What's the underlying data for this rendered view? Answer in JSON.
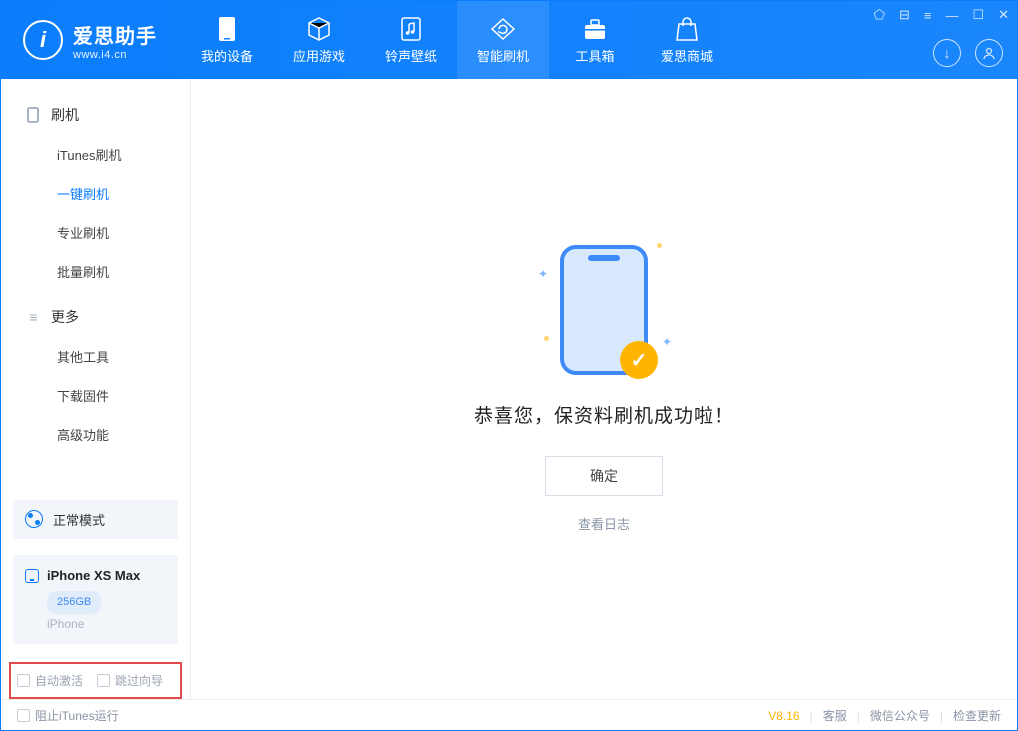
{
  "app": {
    "title": "爱思助手",
    "subtitle": "www.i4.cn"
  },
  "nav": {
    "items": [
      {
        "label": "我的设备"
      },
      {
        "label": "应用游戏"
      },
      {
        "label": "铃声壁纸"
      },
      {
        "label": "智能刷机"
      },
      {
        "label": "工具箱"
      },
      {
        "label": "爱思商城"
      }
    ]
  },
  "sidebar": {
    "groups": [
      {
        "title": "刷机",
        "items": [
          {
            "label": "iTunes刷机"
          },
          {
            "label": "一键刷机",
            "active": true
          },
          {
            "label": "专业刷机"
          },
          {
            "label": "批量刷机"
          }
        ]
      },
      {
        "title": "更多",
        "items": [
          {
            "label": "其他工具"
          },
          {
            "label": "下载固件"
          },
          {
            "label": "高级功能"
          }
        ]
      }
    ],
    "mode_label": "正常模式",
    "device": {
      "name": "iPhone XS Max",
      "capacity": "256GB",
      "type": "iPhone"
    },
    "checkbox_row": {
      "auto_activate": "自动激活",
      "skip_guide": "跳过向导"
    }
  },
  "main": {
    "success_message": "恭喜您，保资料刷机成功啦！",
    "ok_button": "确定",
    "view_log": "查看日志"
  },
  "footer": {
    "block_itunes": "阻止iTunes运行",
    "version": "V8.16",
    "links": {
      "service": "客服",
      "wechat": "微信公众号",
      "update": "检查更新"
    }
  }
}
